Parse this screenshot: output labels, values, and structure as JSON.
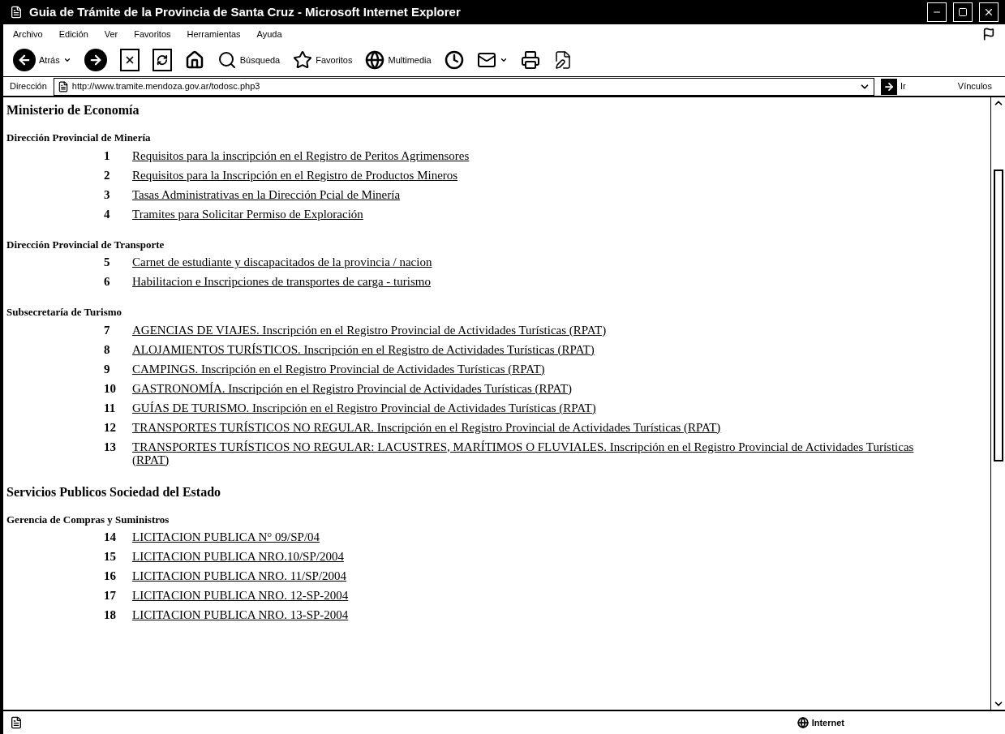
{
  "window": {
    "title": "Guia de Trámite de la Provincia de Santa Cruz - Microsoft Internet Explorer"
  },
  "menu_bar": [
    "Archivo",
    "Edición",
    "Ver",
    "Favoritos",
    "Herramientas",
    "Ayuda"
  ],
  "toolbar": [
    {
      "kind": "back",
      "label": "Atrás",
      "dropdown": true
    },
    {
      "kind": "forward",
      "dropdown": false
    },
    {
      "kind": "stop",
      "dropdown": false
    },
    {
      "kind": "refresh",
      "dropdown": false
    },
    {
      "kind": "home",
      "dropdown": false
    },
    {
      "kind": "search",
      "label": "Búsqueda",
      "dropdown": false
    },
    {
      "kind": "favorites",
      "label": "Favoritos",
      "dropdown": false
    },
    {
      "kind": "media",
      "label": "Multimedia",
      "dropdown": false
    },
    {
      "kind": "history",
      "dropdown": false
    },
    {
      "kind": "mail",
      "dropdown": true
    },
    {
      "kind": "print",
      "dropdown": false
    },
    {
      "kind": "edit",
      "dropdown": false
    }
  ],
  "address_bar": {
    "label": "Dirección",
    "url": "http://www.tramite.mendoza.gov.ar/todosc.php3",
    "go": "Ir",
    "links": "Vínculos"
  },
  "content": [
    {
      "kind": "ministry",
      "title": "Ministerio de Economía"
    },
    {
      "kind": "office",
      "title": "Dirección Provincial de Minería",
      "items": [
        {
          "number": "1",
          "text": "Requisitos para la inscripción en el Registro de Peritos Agrimensores"
        },
        {
          "number": "2",
          "text": "Requisitos para la Inscripción en el Registro de Productos Mineros"
        },
        {
          "number": "3",
          "text": "Tasas Administrativas en la Dirección Pcial de Minería"
        },
        {
          "number": "4",
          "text": "Tramites para Solicitar Permiso de Exploración"
        }
      ]
    },
    {
      "kind": "office",
      "title": "Dirección Provincial de Transporte",
      "items": [
        {
          "number": "5",
          "text": "Carnet de estudiante y discapacitados de la provincia / nacion"
        },
        {
          "number": "6",
          "text": "Habilitacion e Inscripciones de transportes de carga - turismo"
        }
      ]
    },
    {
      "kind": "office",
      "title": "Subsecretaría de Turismo",
      "items": [
        {
          "number": "7",
          "text": "AGENCIAS DE VIAJES. Inscripción en el Registro Provincial de Actividades Turísticas (RPAT)"
        },
        {
          "number": "8",
          "text": "ALOJAMIENTOS TURÍSTICOS. Inscripción en el Registro de Actividades Turísticas (RPAT)"
        },
        {
          "number": "9",
          "text": "CAMPINGS. Inscripción en el Registro Provincial de Actividades Turísticas (RPAT)"
        },
        {
          "number": "10",
          "text": "GASTRONOMÍA. Inscripción en el Registro Provincial de Actividades Turísticas (RPAT)"
        },
        {
          "number": "11",
          "text": "GUÍAS DE TURISMO. Inscripción en el Registro Provincial de Actividades Turísticas (RPAT)"
        },
        {
          "number": "12",
          "text": "TRANSPORTES TURÍSTICOS NO REGULAR. Inscripción en el Registro Provincial de Actividades Turísticas (RPAT)"
        },
        {
          "number": "13",
          "text": "TRANSPORTES TURÍSTICOS NO REGULAR: LACUSTRES, MARÍTIMOS O FLUVIALES. Inscripción en el Registro Provincial de Actividades Turísticas (RPAT)"
        }
      ]
    },
    {
      "kind": "ministry",
      "title": "Servicios Publicos Sociedad del Estado"
    },
    {
      "kind": "office",
      "title": "Gerencia de Compras y Suministros",
      "items": [
        {
          "number": "14",
          "text": "LICITACION PUBLICA N° 09/SP/04"
        },
        {
          "number": "15",
          "text": "LICITACION PUBLICA NRO.10/SP/2004"
        },
        {
          "number": "16",
          "text": "LICITACION PUBLICA NRO. 11/SP/2004"
        },
        {
          "number": "17",
          "text": "LICITACION PUBLICA NRO. 12-SP-2004"
        },
        {
          "number": "18",
          "text": "LICITACION PUBLICA NRO. 13-SP-2004"
        }
      ]
    }
  ],
  "status_bar": {
    "zone": "Internet"
  }
}
